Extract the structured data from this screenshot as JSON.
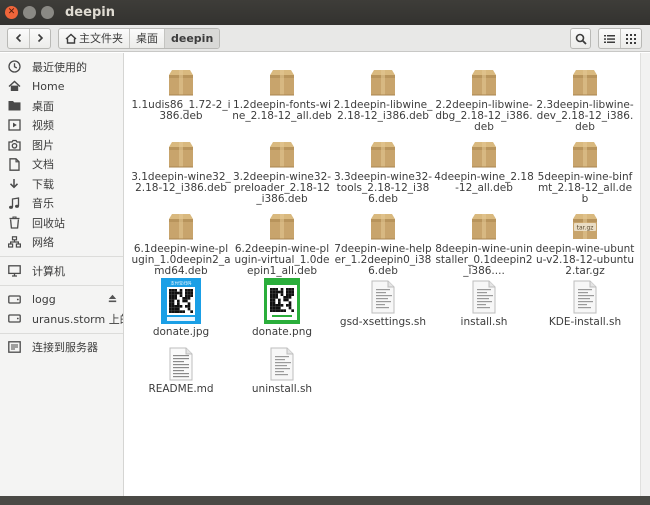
{
  "window": {
    "title": "deepin"
  },
  "path": {
    "crumbs": [
      "主文件夹",
      "桌面",
      "deepin"
    ]
  },
  "sidebar": {
    "groups": [
      [
        {
          "label": "最近使用的",
          "icon": "clock-icon"
        },
        {
          "label": "Home",
          "icon": "home-icon"
        },
        {
          "label": "桌面",
          "icon": "folder-icon"
        },
        {
          "label": "视频",
          "icon": "video-icon"
        },
        {
          "label": "图片",
          "icon": "camera-icon"
        },
        {
          "label": "文档",
          "icon": "document-icon"
        },
        {
          "label": "下载",
          "icon": "download-icon"
        },
        {
          "label": "音乐",
          "icon": "music-icon"
        },
        {
          "label": "回收站",
          "icon": "trash-icon"
        },
        {
          "label": "网络",
          "icon": "network-icon"
        }
      ],
      [
        {
          "label": "计算机",
          "icon": "computer-icon"
        }
      ],
      [
        {
          "label": "logg",
          "icon": "drive-icon"
        },
        {
          "label": "uranus.storm 上的 ...",
          "icon": "drive-icon"
        }
      ],
      [
        {
          "label": "连接到服务器",
          "icon": "server-icon"
        }
      ]
    ]
  },
  "files": [
    {
      "name": "1.1udis86_1.72-2_i386.deb",
      "type": "package"
    },
    {
      "name": "1.2deepin-fonts-wine_2.18-12_all.deb",
      "type": "package"
    },
    {
      "name": "2.1deepin-libwine_2.18-12_i386.deb",
      "type": "package"
    },
    {
      "name": "2.2deepin-libwine-dbg_2.18-12_i386.deb",
      "type": "package"
    },
    {
      "name": "2.3deepin-libwine-dev_2.18-12_i386.deb",
      "type": "package"
    },
    {
      "name": "3.1deepin-wine32_2.18-12_i386.deb",
      "type": "package"
    },
    {
      "name": "3.2deepin-wine32-preloader_2.18-12_i386.deb",
      "type": "package"
    },
    {
      "name": "3.3deepin-wine32-tools_2.18-12_i386.deb",
      "type": "package"
    },
    {
      "name": "4deepin-wine_2.18-12_all.deb",
      "type": "package"
    },
    {
      "name": "5deepin-wine-binfmt_2.18-12_all.deb",
      "type": "package"
    },
    {
      "name": "6.1deepin-wine-plugin_1.0deepin2_amd64.deb",
      "type": "package"
    },
    {
      "name": "6.2deepin-wine-plugin-virtual_1.0deepin1_all.deb",
      "type": "package"
    },
    {
      "name": "7deepin-wine-helper_1.2deepin0_i386.deb",
      "type": "package"
    },
    {
      "name": "8deepin-wine-uninstaller_0.1deepin2_i386....",
      "type": "package"
    },
    {
      "name": "deepin-wine-ubuntu-v2.18-12-ubuntu2.tar.gz",
      "type": "archive",
      "badge": "tar.gz"
    },
    {
      "name": "donate.jpg",
      "type": "image-alipay",
      "thumb_text": "支付宝扫码"
    },
    {
      "name": "donate.png",
      "type": "image-wechat"
    },
    {
      "name": "gsd-xsettings.sh",
      "type": "script"
    },
    {
      "name": "install.sh",
      "type": "script"
    },
    {
      "name": "KDE-install.sh",
      "type": "script"
    },
    {
      "name": "README.md",
      "type": "text"
    },
    {
      "name": "uninstall.sh",
      "type": "script"
    }
  ],
  "colors": {
    "package": "#c8a46c",
    "alipay": "#1a9fe6",
    "wechat": "#2aae3b"
  }
}
